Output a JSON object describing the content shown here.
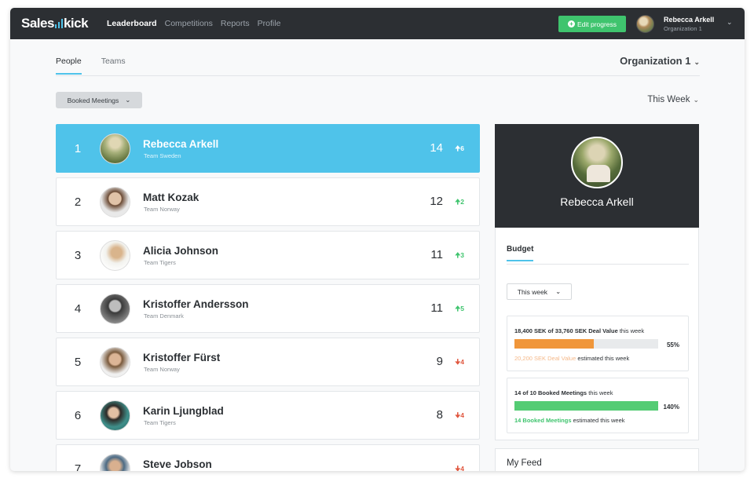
{
  "brand": {
    "name_left": "Sales",
    "name_right": "kick",
    "accent": "#4fc3ea"
  },
  "nav": {
    "items": [
      "Leaderboard",
      "Competitions",
      "Reports",
      "Profile"
    ],
    "active": "Leaderboard"
  },
  "header": {
    "edit_button": "Edit progress",
    "user_name": "Rebecca Arkell",
    "user_org": "Organization 1"
  },
  "tabs": {
    "people": "People",
    "teams": "Teams"
  },
  "organization_select": "Organization 1",
  "filter": {
    "metric": "Booked Meetings",
    "period": "This Week"
  },
  "leaderboard": [
    {
      "rank": "1",
      "name": "Rebecca Arkell",
      "team": "Team Sweden",
      "score": "14",
      "delta": "6",
      "direction": "up"
    },
    {
      "rank": "2",
      "name": "Matt Kozak",
      "team": "Team Norway",
      "score": "12",
      "delta": "2",
      "direction": "up"
    },
    {
      "rank": "3",
      "name": "Alicia Johnson",
      "team": "Team Tigers",
      "score": "11",
      "delta": "3",
      "direction": "up"
    },
    {
      "rank": "4",
      "name": "Kristoffer Andersson",
      "team": "Team Denmark",
      "score": "11",
      "delta": "5",
      "direction": "up"
    },
    {
      "rank": "5",
      "name": "Kristoffer Fürst",
      "team": "Team Norway",
      "score": "9",
      "delta": "4",
      "direction": "down"
    },
    {
      "rank": "6",
      "name": "Karin Ljungblad",
      "team": "Team Tigers",
      "score": "8",
      "delta": "4",
      "direction": "down"
    },
    {
      "rank": "7",
      "name": "Steve Jobson",
      "team": "",
      "score": "",
      "delta": "4",
      "direction": "down"
    }
  ],
  "profile": {
    "name": "Rebecca Arkell"
  },
  "budget": {
    "tab": "Budget",
    "period": "This week",
    "deal": {
      "amount": "18,400 SEK of 33,760 SEK Deal Value",
      "suffix": "this week",
      "percent_label": "55%",
      "progress": 0.55,
      "color": "#f0963a",
      "estimate": "20,200 SEK Deal Value",
      "estimate_suffix": "estimated this week"
    },
    "meetings": {
      "amount": "14 of 10 Booked Meetings",
      "suffix": "this week",
      "percent_label": "140%",
      "progress": 1.0,
      "color": "#54cc74",
      "estimate": "14 Booked Meetings",
      "estimate_suffix": "estimated this week"
    }
  },
  "feed": {
    "title": "My Feed"
  }
}
